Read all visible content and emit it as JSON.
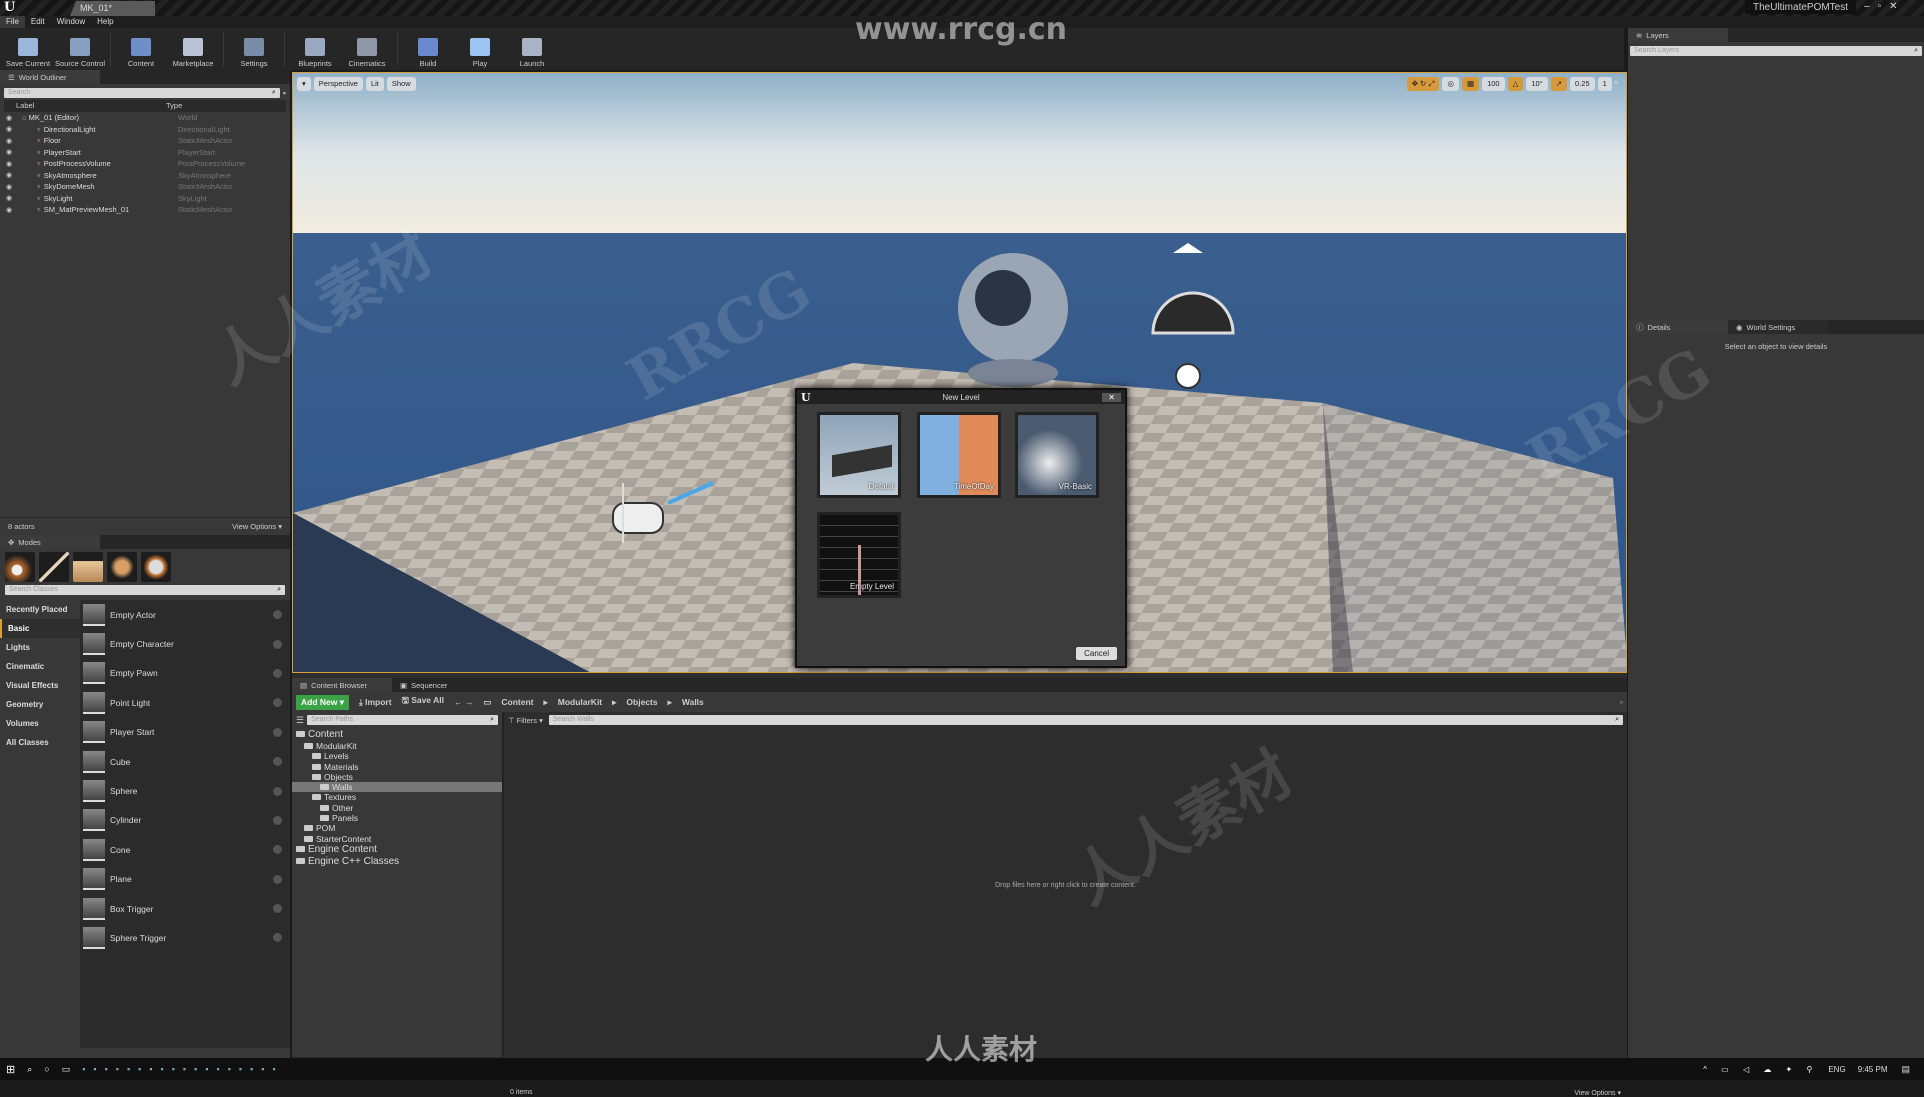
{
  "window": {
    "doc_tab": "MK_01*",
    "project": "TheUltimatePOMTest",
    "controls": [
      "–",
      "▫",
      "✕"
    ]
  },
  "menu": [
    "File",
    "Edit",
    "Window",
    "Help"
  ],
  "toolbar": [
    {
      "label": "Save Current",
      "color": "#9bb6d8"
    },
    {
      "label": "Source Control",
      "color": "#8aa0c0"
    },
    {
      "label": "Content",
      "color": "#6f8fc8"
    },
    {
      "label": "Marketplace",
      "color": "#b8c4d6"
    },
    {
      "label": "Settings",
      "color": "#7a8ca8"
    },
    {
      "label": "Blueprints",
      "color": "#9aa8c0"
    },
    {
      "label": "Cinematics",
      "color": "#8e97a8"
    },
    {
      "label": "Build",
      "color": "#6a8ad0"
    },
    {
      "label": "Play",
      "color": "#9cc4f0"
    },
    {
      "label": "Launch",
      "color": "#a8b4c6"
    }
  ],
  "outliner": {
    "tab": "World Outliner",
    "search_placeholder": "Search",
    "col_label": "Label",
    "col_type": "Type",
    "rows": [
      {
        "label": "MK_01 (Editor)",
        "type": "World"
      },
      {
        "label": "DirectionalLight",
        "type": "DirectionalLight"
      },
      {
        "label": "Floor",
        "type": "StaticMeshActor"
      },
      {
        "label": "PlayerStart",
        "type": "PlayerStart"
      },
      {
        "label": "PostProcessVolume",
        "type": "PostProcessVolume"
      },
      {
        "label": "SkyAtmosphere",
        "type": "SkyAtmosphere"
      },
      {
        "label": "SkyDomeMesh",
        "type": "StaticMeshActor"
      },
      {
        "label": "SkyLight",
        "type": "SkyLight"
      },
      {
        "label": "SM_MatPreviewMesh_01",
        "type": "StaticMeshActor"
      }
    ],
    "count": "8 actors",
    "view_options": "View Options ▾"
  },
  "modes": {
    "tab": "Modes",
    "search_placeholder": "Search Classes",
    "categories": [
      "Recently Placed",
      "Basic",
      "Lights",
      "Cinematic",
      "Visual Effects",
      "Geometry",
      "Volumes",
      "All Classes"
    ],
    "active_category": "Basic",
    "items": [
      "Empty Actor",
      "Empty Character",
      "Empty Pawn",
      "Point Light",
      "Player Start",
      "Cube",
      "Sphere",
      "Cylinder",
      "Cone",
      "Plane",
      "Box Trigger",
      "Sphere Trigger"
    ]
  },
  "viewport": {
    "perspective": "Perspective",
    "lit": "Lit",
    "show": "Show",
    "grid_snap": "100",
    "rot_snap": "10°",
    "scale_snap": "0.25",
    "camera_speed": "1"
  },
  "layers": {
    "tab": "Layers",
    "search_placeholder": "Search Layers"
  },
  "details": {
    "tab1": "Details",
    "tab2": "World Settings",
    "empty": "Select an object to view details"
  },
  "dialog": {
    "title": "New Level",
    "templates": [
      "Default",
      "TimeOfDay",
      "VR-Basic",
      "Empty Level"
    ],
    "cancel": "Cancel"
  },
  "content_browser": {
    "tab1": "Content Browser",
    "tab2": "Sequencer",
    "add_new": "Add New ▾",
    "import": "Import",
    "save_all": "Save All",
    "breadcrumb": [
      "Content",
      "ModularKit",
      "Objects",
      "Walls"
    ],
    "search_paths": "Search Paths",
    "filters": "Filters ▾",
    "search_assets": "Search Walls",
    "tree": [
      {
        "label": "Content",
        "depth": 0,
        "big": true
      },
      {
        "label": "ModularKit",
        "depth": 1
      },
      {
        "label": "Levels",
        "depth": 2
      },
      {
        "label": "Materials",
        "depth": 2
      },
      {
        "label": "Objects",
        "depth": 2
      },
      {
        "label": "Walls",
        "depth": 3,
        "selected": true
      },
      {
        "label": "Textures",
        "depth": 2
      },
      {
        "label": "Other",
        "depth": 3
      },
      {
        "label": "Panels",
        "depth": 3
      },
      {
        "label": "POM",
        "depth": 1
      },
      {
        "label": "StarterContent",
        "depth": 1
      },
      {
        "label": "Engine Content",
        "depth": 0,
        "big": true
      },
      {
        "label": "Engine C++ Classes",
        "depth": 0,
        "big": true
      }
    ],
    "drop_hint": "Drop files here or right click to create content.",
    "items_count": "0 items",
    "view_options": "View Options ▾"
  },
  "taskbar": {
    "lang": "ENG",
    "time": "9:45 PM"
  },
  "watermark": {
    "site": "www.rrcg.cn",
    "brand": "RRCG",
    "cn": "人人素材"
  }
}
